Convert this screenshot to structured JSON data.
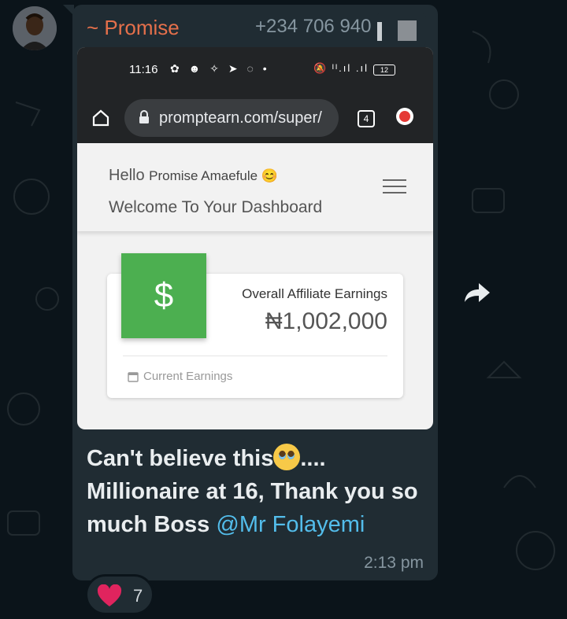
{
  "message": {
    "sender_name": "~ Promise",
    "sender_phone": "+234 706 940",
    "text_line1": "Can't believe this",
    "text_line1_suffix": "....",
    "text_line2": "Millionaire at 16, Thank you so much Boss ",
    "mention": "@Mr Folayemi",
    "timestamp": "2:13 pm",
    "reaction_count": "7"
  },
  "screenshot": {
    "status_time": "11:16",
    "battery": "12",
    "url": "promptearn.com/super/",
    "tab_count": "4",
    "greeting_prefix": "Hello ",
    "user_name": "Promise Amaefule 😊",
    "welcome": "Welcome To Your Dashboard",
    "card_label": "Overall Affiliate Earnings",
    "card_value": "₦1,002,000",
    "card_footer": "Current Earnings",
    "dollar_symbol": "$"
  },
  "colors": {
    "background": "#0b141a",
    "bubble": "#202c33",
    "sender": "#e5704b",
    "mention": "#53bdeb",
    "dashboard_green": "#4caf50"
  },
  "icons": [
    "avatar",
    "home-icon",
    "lock-icon",
    "tabs-icon",
    "update-icon",
    "menu-icon",
    "dollar-icon",
    "calendar-icon",
    "heart-icon",
    "forward-icon"
  ]
}
